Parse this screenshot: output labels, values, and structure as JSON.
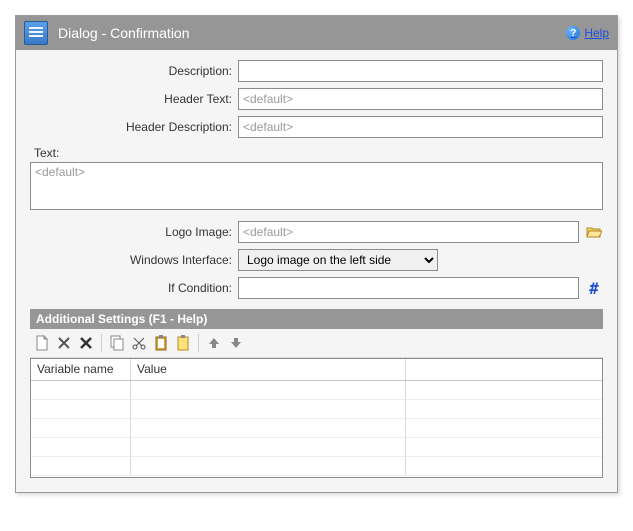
{
  "title": "Dialog - Confirmation",
  "help_label": "Help",
  "labels": {
    "description": "Description:",
    "header_text": "Header Text:",
    "header_description": "Header Description:",
    "text": "Text:",
    "logo_image": "Logo Image:",
    "windows_interface": "Windows Interface:",
    "if_condition": "If Condition:"
  },
  "values": {
    "description": "",
    "header_text": "",
    "header_description": "",
    "text": "",
    "logo_image": "",
    "windows_interface": "Logo image on the left side",
    "if_condition": ""
  },
  "placeholders": {
    "default": "<default>"
  },
  "subheader": "Additional Settings (F1 - Help)",
  "grid": {
    "headers": {
      "variable_name": "Variable name",
      "value": "Value"
    },
    "rows": []
  }
}
